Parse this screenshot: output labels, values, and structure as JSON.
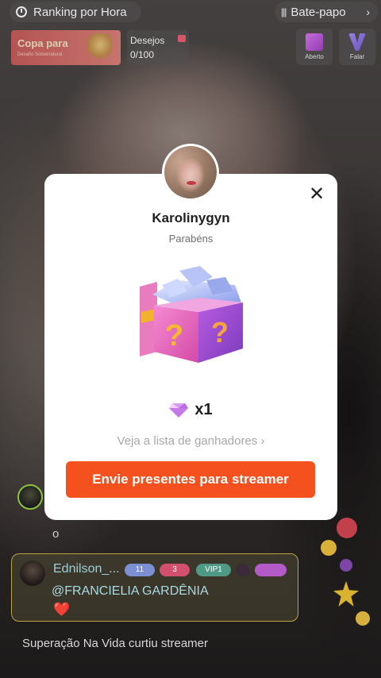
{
  "top_bar": {
    "ranking_label": "Ranking por Hora",
    "chat_label": "Bate-papo",
    "chat_chevron": "›"
  },
  "banner": {
    "cup_title": "Copa para",
    "cup_subtitle": "Desafio Sobrenatural",
    "wishes_label": "Desejos",
    "wishes_count": "0/100"
  },
  "top_buttons": {
    "aberto_label": "Aberto",
    "falar_label": "Falar"
  },
  "modal": {
    "streamer_name": "Karolinygyn",
    "subtitle": "Parabéns",
    "prize_icon": "diamond-icon",
    "prize_quantity": "x1",
    "winners_link": "Veja a lista de ganhadores ›",
    "send_button": "Envie presentes para streamer",
    "close_symbol": "✕"
  },
  "chat": {
    "small_text": "o",
    "message": {
      "user": "Ednilson_...",
      "badges": [
        "11",
        "3",
        "VIP1",
        "",
        ""
      ],
      "text": "@FRANCIELIA GARDÊNIA",
      "emoji": "❤️"
    },
    "notification": "Superação Na Vida curtiu streamer"
  },
  "colors": {
    "accent": "#f4511e",
    "modal_bg": "#ffffff"
  }
}
